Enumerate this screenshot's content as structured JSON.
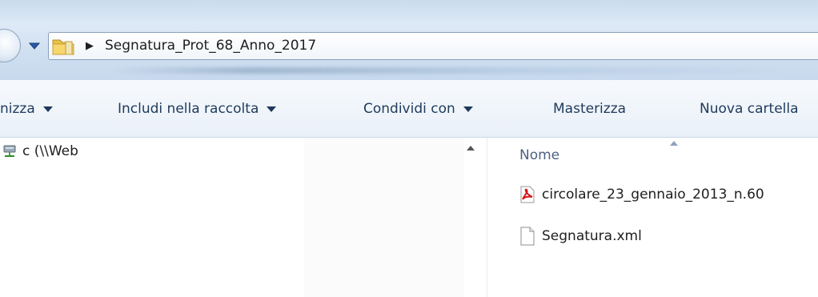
{
  "window": {
    "address": {
      "current_folder": "Segnatura_Prot_68_Anno_2017",
      "icons": {
        "back": "back-arrow-icon",
        "dropdown": "chevron-down-icon",
        "folder": "folder-icon",
        "separator": "breadcrumb-arrow-icon"
      }
    }
  },
  "toolbar": {
    "items": [
      {
        "label": "nizza",
        "has_menu": true
      },
      {
        "label": "Includi nella raccolta",
        "has_menu": true
      },
      {
        "label": "Condividi con",
        "has_menu": true
      },
      {
        "label": "Masterizza",
        "has_menu": false
      },
      {
        "label": "Nuova cartella",
        "has_menu": false
      }
    ]
  },
  "nav_pane": {
    "items": [
      {
        "label": "c (\\\\Web",
        "icon": "network-drive-icon"
      }
    ]
  },
  "file_list": {
    "column_header": "Nome",
    "files": [
      {
        "name": "circolare_23_gennaio_2013_n.60",
        "icon": "pdf-file-icon"
      },
      {
        "name": "Segnatura.xml",
        "icon": "generic-file-icon"
      }
    ]
  },
  "colors": {
    "accent": "#1e3a5c",
    "header_text": "#4d6185",
    "pdf_red": "#d2161b"
  }
}
